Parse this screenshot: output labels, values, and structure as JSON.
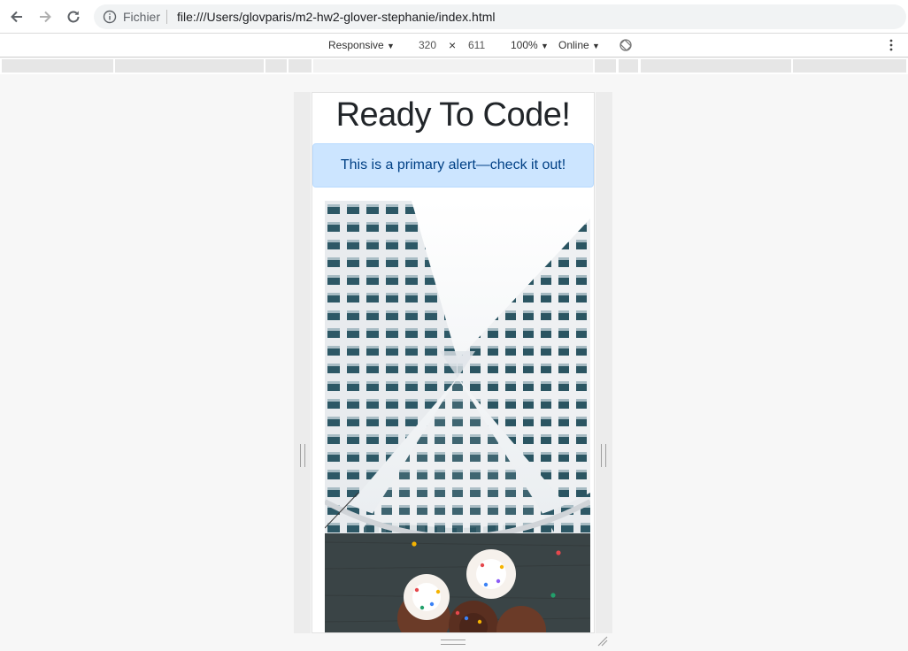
{
  "browser": {
    "scheme_label": "Fichier",
    "url": "file:///Users/glovparis/m2-hw2-glover-stephanie/index.html"
  },
  "device_toolbar": {
    "device": "Responsive",
    "width": "320",
    "times": "×",
    "height": "611",
    "zoom": "100%",
    "network": "Online"
  },
  "page": {
    "heading": "Ready To Code!",
    "alert": "This is a primary alert—check it out!"
  },
  "images": {
    "first": "building-photo",
    "second": "cupcakes-photo"
  },
  "colors": {
    "alert_bg": "#cce5ff",
    "alert_text": "#004085",
    "heading": "#212529"
  }
}
